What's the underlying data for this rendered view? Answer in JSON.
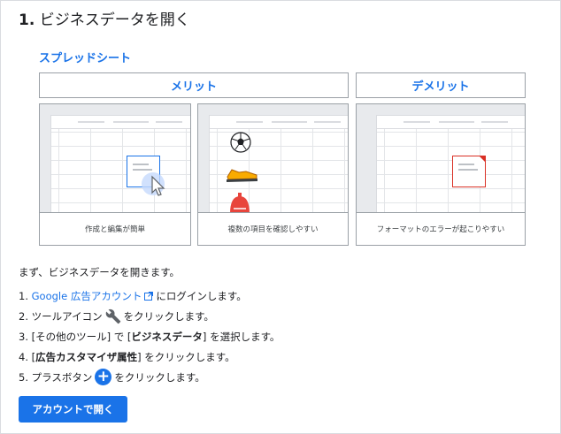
{
  "heading": {
    "number": "1.",
    "text": "ビジネスデータを開く"
  },
  "subheading": "スプレッドシート",
  "columns": {
    "merit": "メリット",
    "demerit": "デメリット"
  },
  "cards": [
    {
      "caption": "作成と編集が簡単"
    },
    {
      "caption": "複数の項目を確認しやすい"
    },
    {
      "caption": "フォーマットのエラーが起こりやすい"
    }
  ],
  "intro": "まず、ビジネスデータを開きます。",
  "steps": {
    "s1": {
      "num": "1.",
      "link": "Google 広告アカウント",
      "after": " にログインします。"
    },
    "s2": {
      "num": "2.",
      "before": "ツールアイコン",
      "after": " をクリックします。"
    },
    "s3": {
      "num": "3.",
      "p1": "[その他のツール] で [",
      "bold": "ビジネスデータ",
      "p2": "] を選択します。"
    },
    "s4": {
      "num": "4.",
      "p1": "[",
      "bold": "広告カスタマイザ属性",
      "p2": "] をクリックします。"
    },
    "s5": {
      "num": "5.",
      "before": "プラスボタン",
      "after": " をクリックします。"
    }
  },
  "button": "アカウントで開く",
  "icons": {
    "external": "external-link-icon",
    "tool": "wrench-icon",
    "plus": "plus-circle-icon"
  },
  "colors": {
    "accent": "#1a73e8",
    "error": "#d93025",
    "text": "#202124"
  }
}
